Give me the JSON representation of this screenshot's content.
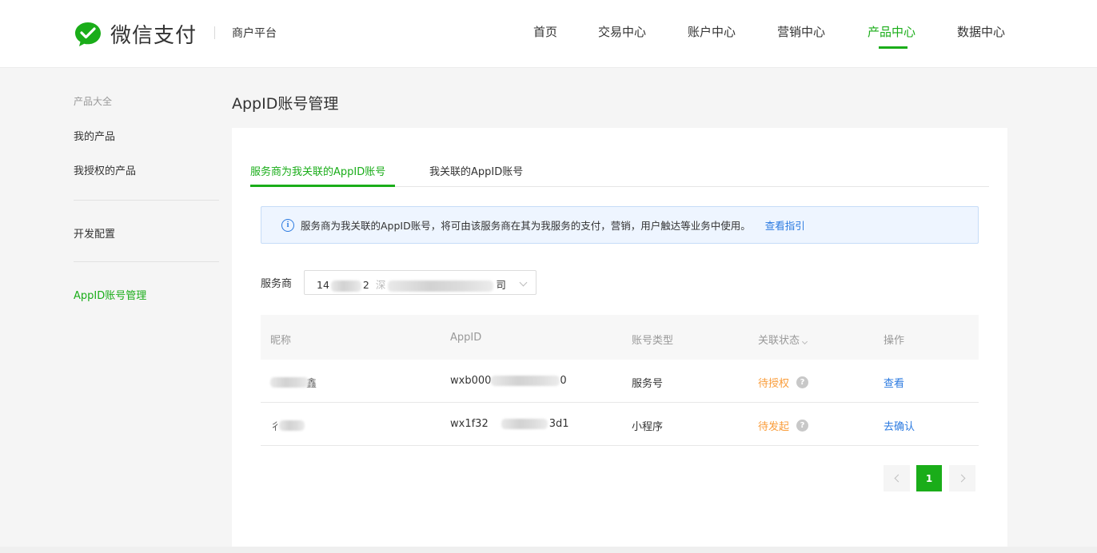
{
  "header": {
    "logo_text": "微信支付",
    "platform": "商户平台",
    "nav": [
      {
        "label": "首页",
        "active": false
      },
      {
        "label": "交易中心",
        "active": false
      },
      {
        "label": "账户中心",
        "active": false
      },
      {
        "label": "营销中心",
        "active": false
      },
      {
        "label": "产品中心",
        "active": true
      },
      {
        "label": "数据中心",
        "active": false
      }
    ],
    "brand_color": "#1aad19"
  },
  "sidebar": {
    "group_title": "产品大全",
    "items": [
      {
        "label": "我的产品",
        "active": false
      },
      {
        "label": "我授权的产品",
        "active": false
      },
      {
        "label": "开发配置",
        "active": false
      },
      {
        "label": "AppID账号管理",
        "active": true
      }
    ]
  },
  "main": {
    "title": "AppID账号管理",
    "tabs": [
      {
        "label": "服务商为我关联的AppID账号",
        "active": true
      },
      {
        "label": "我关联的AppID账号",
        "active": false
      }
    ],
    "notice": {
      "icon": "info-icon",
      "text": "服务商为我关联的AppID账号，将可由该服务商在其为我服务的支付，营销，用户触达等业务中使用。",
      "link": "查看指引"
    },
    "filter": {
      "label": "服务商",
      "value_prefix": "14",
      "value_mid": "2",
      "value_char": "深",
      "value_suffix": "司"
    },
    "table": {
      "columns": [
        "昵称",
        "AppID",
        "账号类型",
        "关联状态",
        "操作"
      ],
      "rows": [
        {
          "nickname_suffix": "鑫",
          "appid_prefix": "wxb000",
          "appid_suffix": "0",
          "type": "服务号",
          "status": "待授权",
          "action": "查看"
        },
        {
          "nickname_prefix": "彳",
          "appid_prefix": "wx1f32",
          "appid_suffix": "3d1",
          "type": "小程序",
          "status": "待发起",
          "action": "去确认"
        }
      ],
      "status_color": "#fa9d3b",
      "link_color": "#2b7ae0"
    },
    "pagination": {
      "current": "1"
    }
  }
}
